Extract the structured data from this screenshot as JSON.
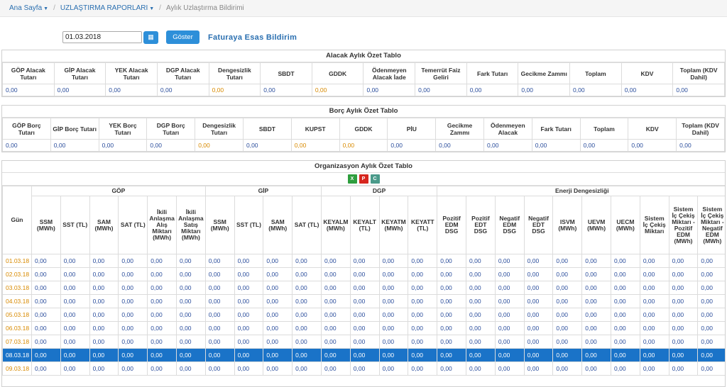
{
  "breadcrumb": {
    "home": "Ana Sayfa",
    "reports": "UZLAŞTIRMA RAPORLARI",
    "current": "Aylık Uzlaştırma Bildirimi"
  },
  "controls": {
    "date": "01.03.2018",
    "show": "Göster",
    "title": "Faturaya Esas Bildirim"
  },
  "alacak": {
    "title": "Alacak Aylık Özet Tablo",
    "headers": [
      "GÖP Alacak Tutarı",
      "GİP Alacak Tutarı",
      "YEK Alacak Tutarı",
      "DGP Alacak Tutarı",
      "Dengesizlik Tutarı",
      "SBDT",
      "GDDK",
      "Ödenmeyen Alacak İade",
      "Temerrüt Faiz Geliri",
      "Fark Tutarı",
      "Gecikme Zammı",
      "Toplam",
      "KDV",
      "Toplam (KDV Dahil)"
    ],
    "values": [
      "0,00",
      "0,00",
      "0,00",
      "0,00",
      "0,00",
      "0,00",
      "0,00",
      "0,00",
      "0,00",
      "0,00",
      "0,00",
      "0,00",
      "0,00",
      "0,00"
    ]
  },
  "borc": {
    "title": "Borç Aylık Özet Tablo",
    "headers": [
      "GÖP Borç Tutarı",
      "GİP Borç Tutarı",
      "YEK Borç Tutarı",
      "DGP Borç Tutarı",
      "Dengesizlik Tutarı",
      "SBDT",
      "KUPST",
      "GDDK",
      "PİU",
      "Gecikme Zammı",
      "Ödenmeyen Alacak",
      "Fark Tutarı",
      "Toplam",
      "KDV",
      "Toplam (KDV Dahil)"
    ],
    "values": [
      "0,00",
      "0,00",
      "0,00",
      "0,00",
      "0,00",
      "0,00",
      "0,00",
      "0,00",
      "0,00",
      "0,00",
      "0,00",
      "0,00",
      "0,00",
      "0,00",
      "0,00"
    ]
  },
  "org": {
    "title": "Organizasyon Aylık Özet Tablo",
    "icons": [
      "excel-icon",
      "pdf-icon",
      "csv-icon"
    ],
    "dayHeader": "Gün",
    "groups": [
      "GÖP",
      "GİP",
      "DGP",
      "Enerji Dengesizliği"
    ],
    "subheaders": [
      "SSM (MWh)",
      "SST (TL)",
      "SAM (MWh)",
      "SAT (TL)",
      "İkili Anlaşma Alış Miktarı (MWh)",
      "İkili Anlaşma Satış Miktarı (MWh)",
      "SSM (MWh)",
      "SST (TL)",
      "SAM (MWh)",
      "SAT (TL)",
      "KEYALM (MWh)",
      "KEYALT (TL)",
      "KEYATM (MWh)",
      "KEYATT (TL)",
      "Pozitif EDM DSG",
      "Pozitif EDT DSG",
      "Negatif EDM DSG",
      "Negatif EDT DSG",
      "ISVM (MWh)",
      "UEVM (MWh)",
      "UECM (MWh)",
      "Sistem İç Çekiş Miktarı",
      "Sistem İç Çekiş Miktarı - Pozitif EDM (MWh)",
      "Sistem İç Çekiş Miktarı - Negatif EDM (MWh)"
    ],
    "days": [
      "01.03.18",
      "02.03.18",
      "03.03.18",
      "04.03.18",
      "05.03.18",
      "06.03.18",
      "07.03.18",
      "08.03.18",
      "09.03.18"
    ],
    "cell": "0,00",
    "selectedIndex": 7
  }
}
